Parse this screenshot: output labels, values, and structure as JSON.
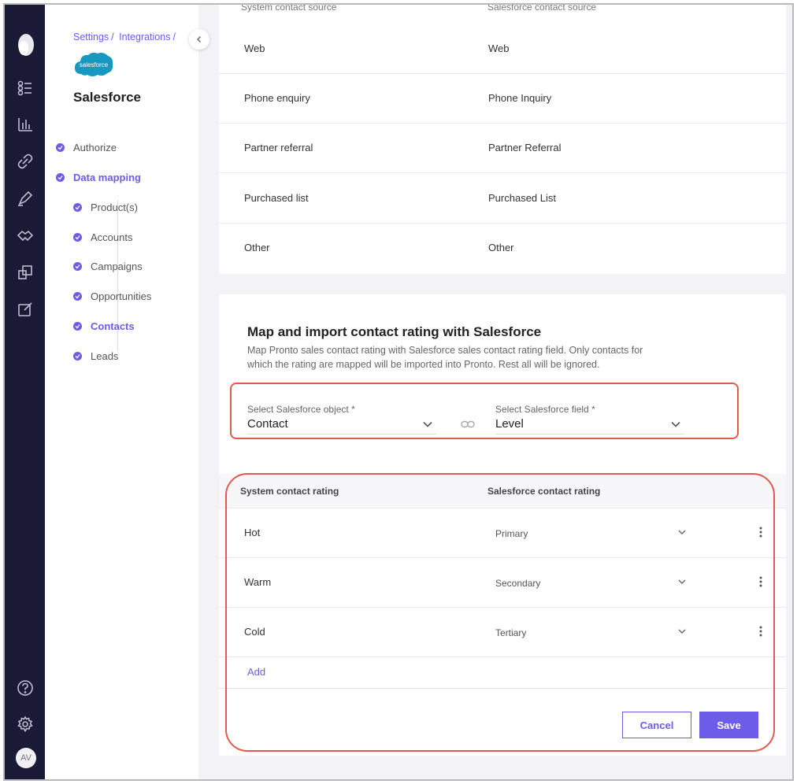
{
  "breadcrumb": [
    "Settings",
    "Integrations"
  ],
  "integration": {
    "name": "Salesforce",
    "logo_text": "salesforce",
    "brand_color": "#1798c1"
  },
  "user": {
    "initials": "AV"
  },
  "accent_color": "#6c5ce7",
  "highlight_color": "#e05a4e",
  "nav": {
    "authorize": "Authorize",
    "data_mapping": "Data mapping",
    "products": "Product(s)",
    "accounts": "Accounts",
    "campaigns": "Campaigns",
    "opportunities": "Opportunities",
    "contacts": "Contacts",
    "leads": "Leads",
    "active": "Contacts"
  },
  "source_table": {
    "headers": [
      "System contact source",
      "Salesforce contact source"
    ],
    "rows": [
      [
        "Web",
        "Web"
      ],
      [
        "Phone enquiry",
        "Phone Inquiry"
      ],
      [
        "Partner referral",
        "Partner Referral"
      ],
      [
        "Purchased list",
        "Purchased List"
      ],
      [
        "Other",
        "Other"
      ]
    ]
  },
  "rating_section": {
    "title": "Map and import contact rating with Salesforce",
    "description": "Map Pronto sales contact rating with Salesforce sales contact rating field. Only contacts for which the rating are mapped will be imported into Pronto. Rest all will be ignored.",
    "object_label": "Select Salesforce object *",
    "object_value": "Contact",
    "field_label": "Select Salesforce field *",
    "field_value": "Level"
  },
  "rating_table": {
    "headers": [
      "System contact rating",
      "Salesforce contact rating"
    ],
    "rows": [
      [
        "Hot",
        "Primary"
      ],
      [
        "Warm",
        "Secondary"
      ],
      [
        "Cold",
        "Tertiary"
      ]
    ],
    "add_label": "Add"
  },
  "actions": {
    "cancel": "Cancel",
    "save": "Save"
  }
}
